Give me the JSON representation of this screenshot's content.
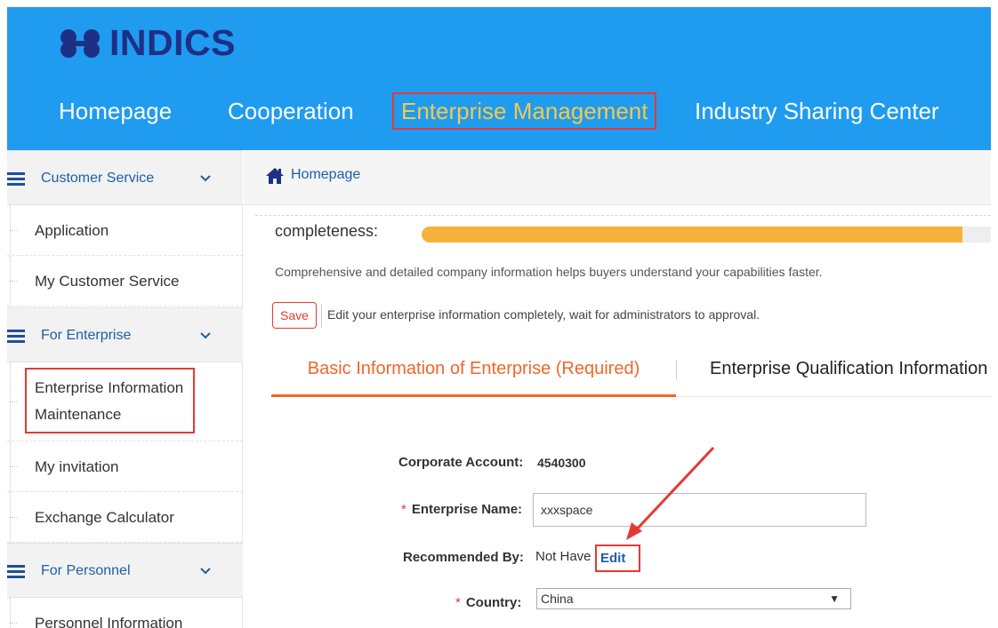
{
  "header": {
    "logo_text": "INDICS",
    "nav": [
      {
        "label": "Homepage",
        "active": false
      },
      {
        "label": "Cooperation",
        "active": false
      },
      {
        "label": "Enterprise Management",
        "active": true
      },
      {
        "label": "Industry Sharing Center",
        "active": false
      }
    ]
  },
  "sidebar": {
    "groups": [
      {
        "label": "Customer Service",
        "items": [
          "Application",
          "My Customer Service"
        ]
      },
      {
        "label": "For Enterprise",
        "items": [
          "Enterprise Information Maintenance",
          "My invitation",
          "Exchange Calculator"
        ]
      },
      {
        "label": "For Personnel",
        "items": [
          "Personnel Information"
        ]
      }
    ]
  },
  "breadcrumb": {
    "home": "Homepage"
  },
  "main": {
    "completeness_label": "completeness:",
    "completeness_value": 0.95,
    "helper_text": "Comprehensive and detailed company information helps buyers understand your capabilities faster.",
    "save_label": "Save",
    "save_note": "Edit your enterprise information completely, wait for administrators to approval.",
    "tabs": [
      {
        "label": "Basic Information of Enterprise (Required)",
        "active": true
      },
      {
        "label": "Enterprise Qualification Information",
        "active": false
      }
    ],
    "form": {
      "corporate_account_label": "Corporate Account:",
      "corporate_account_value": "4540300",
      "enterprise_name_label": "Enterprise Name:",
      "enterprise_name_value": "xxxspace",
      "recommended_by_label": "Recommended By:",
      "recommended_by_value": "Not Have",
      "edit_label": "Edit",
      "country_label": "Country:",
      "country_value": "China",
      "required_mark": "*"
    }
  },
  "colors": {
    "header_bg": "#1f9bf0",
    "logo": "#1e2f86",
    "active_nav": "#f7c948",
    "highlight": "#e53935",
    "accent": "#f0672a",
    "progress": "#f7b23b",
    "link": "#1e5fa8"
  },
  "icons": [
    "logo-mark-icon",
    "menu-icon",
    "chevron-down-icon",
    "home-icon",
    "dropdown-caret-icon"
  ]
}
